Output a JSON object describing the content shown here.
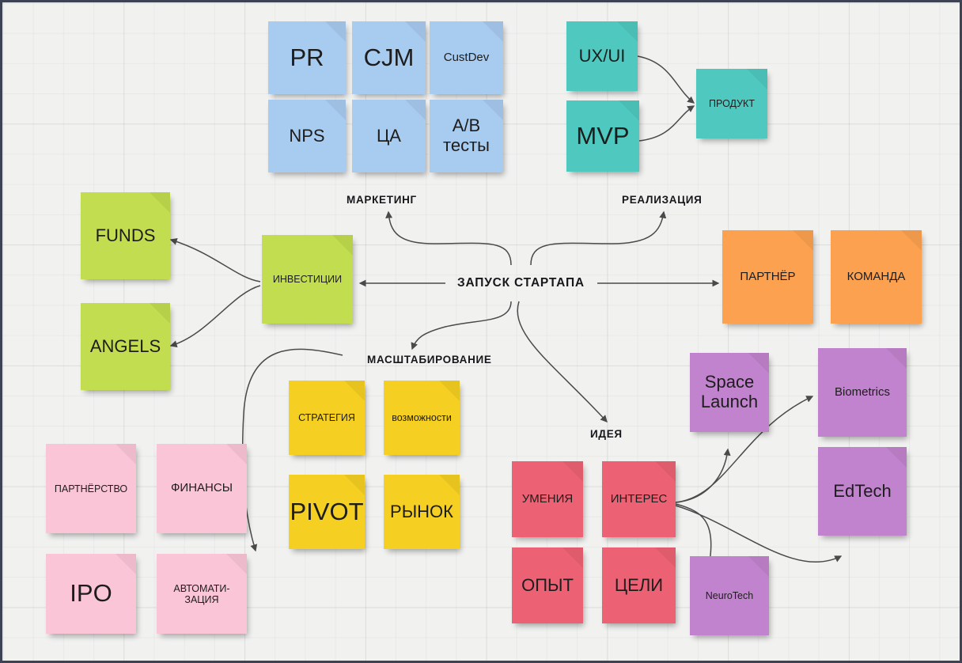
{
  "board": {
    "title": "ЗАПУСК СТАРТАПА",
    "background_color": "#f1f1f0",
    "border_color": "#3e4354"
  },
  "hub": {
    "label": "ЗАПУСК СТАРТАПА"
  },
  "branches": {
    "marketing": "МАРКЕТИНГ",
    "realization": "РЕАЛИЗАЦИЯ",
    "scaling": "МАСШТАБИРОВАНИЕ",
    "idea": "ИДЕЯ"
  },
  "palette": {
    "blue": "#a8cbf0",
    "green": "#c2dd4f",
    "teal": "#4fc9c0",
    "orange": "#fba14f",
    "yellow": "#f5cf21",
    "pink": "#fbc5d8",
    "red": "#ec6274",
    "purple": "#c183cd"
  },
  "notes": {
    "marketing": [
      {
        "label": "PR",
        "color": "#a8cbf0",
        "size": "lg"
      },
      {
        "label": "CJM",
        "color": "#a8cbf0",
        "size": "lg"
      },
      {
        "label": "CustDev",
        "color": "#a8cbf0",
        "size": "sm"
      },
      {
        "label": "NPS",
        "color": "#a8cbf0",
        "size": "md"
      },
      {
        "label": "ЦА",
        "color": "#a8cbf0",
        "size": "md"
      },
      {
        "label": "A/B тесты",
        "color": "#a8cbf0",
        "size": "md"
      }
    ],
    "realization": [
      {
        "label": "UX/UI",
        "color": "#4fc9c0",
        "size": "md"
      },
      {
        "label": "MVP",
        "color": "#4fc9c0",
        "size": "lg"
      },
      {
        "label": "ПРОДУКТ",
        "color": "#4fc9c0",
        "size": "xs"
      }
    ],
    "investments": [
      {
        "label": "FUNDS",
        "color": "#c2dd4f",
        "size": "md"
      },
      {
        "label": "ANGELS",
        "color": "#c2dd4f",
        "size": "md"
      },
      {
        "label": "ИНВЕСТИЦИИ",
        "color": "#c2dd4f",
        "size": "xs"
      }
    ],
    "partners": [
      {
        "label": "ПАРТНЁР",
        "color": "#fba14f",
        "size": "sm"
      },
      {
        "label": "КОМАНДА",
        "color": "#fba14f",
        "size": "sm"
      }
    ],
    "scaling": [
      {
        "label": "СТРАТЕГИЯ",
        "color": "#f5cf21",
        "size": "xs"
      },
      {
        "label": "возможности",
        "color": "#f5cf21",
        "size": "xs"
      },
      {
        "label": "PIVOT",
        "color": "#f5cf21",
        "size": "lg"
      },
      {
        "label": "РЫНОК",
        "color": "#f5cf21",
        "size": "md"
      }
    ],
    "finance": [
      {
        "label": "ПАРТНЁРСТВО",
        "color": "#fbc5d8",
        "size": "xs"
      },
      {
        "label": "ФИНАНСЫ",
        "color": "#fbc5d8",
        "size": "sm"
      },
      {
        "label": "IPO",
        "color": "#fbc5d8",
        "size": "lg"
      },
      {
        "label": "АВТОМАТИ-ЗАЦИЯ",
        "color": "#fbc5d8",
        "size": "xs"
      }
    ],
    "idea": [
      {
        "label": "УМЕНИЯ",
        "color": "#ec6274",
        "size": "sm"
      },
      {
        "label": "ИНТЕРЕС",
        "color": "#ec6274",
        "size": "sm"
      },
      {
        "label": "ОПЫТ",
        "color": "#ec6274",
        "size": "md"
      },
      {
        "label": "ЦЕЛИ",
        "color": "#ec6274",
        "size": "md"
      }
    ],
    "tech": [
      {
        "label": "Space Launch",
        "color": "#c183cd",
        "size": "md"
      },
      {
        "label": "Biometrics",
        "color": "#c183cd",
        "size": "sm"
      },
      {
        "label": "EdTech",
        "color": "#c183cd",
        "size": "md"
      },
      {
        "label": "NeuroTech",
        "color": "#c183cd",
        "size": "xs"
      }
    ]
  }
}
